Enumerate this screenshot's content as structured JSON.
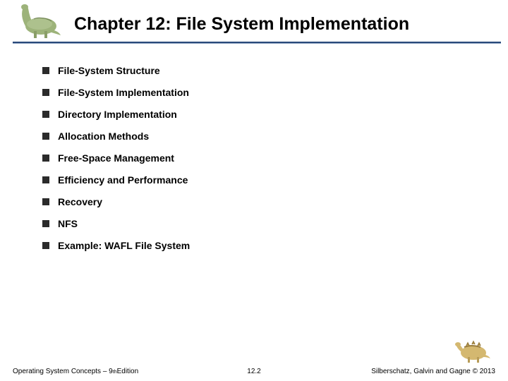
{
  "title": "Chapter 12: File System Implementation",
  "bullets": [
    "File-System Structure",
    "File-System Implementation",
    "Directory Implementation",
    "Allocation Methods",
    "Free-Space Management",
    "Efficiency and Performance",
    "Recovery",
    "NFS",
    "Example: WAFL File System"
  ],
  "footer": {
    "left_prefix": "Operating System Concepts – 9",
    "left_sup": "th",
    "left_suffix": " Edition",
    "center": "12.2",
    "right": "Silberschatz, Galvin and Gagne © 2013"
  }
}
